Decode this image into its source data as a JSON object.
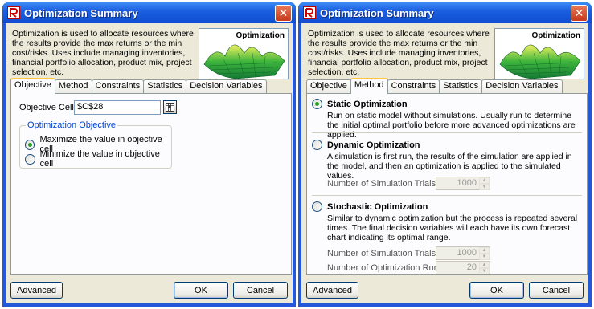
{
  "dialogs": [
    {
      "title": "Optimization Summary",
      "intro": "Optimization is used to allocate resources where the results provide the max returns or the min cost/risks. Uses include managing inventories, financial portfolio allocation, product mix, project selection, etc.",
      "logo_label": "Optimization",
      "tabs": [
        "Objective",
        "Method",
        "Constraints",
        "Statistics",
        "Decision Variables"
      ],
      "active_tab": "Objective",
      "objective": {
        "cell_label": "Objective Cell",
        "cell_value": "$C$28",
        "group_caption": "Optimization Objective",
        "options": [
          {
            "label": "Maximize the value in objective cell",
            "selected": true
          },
          {
            "label": "Minimize the value in objective cell",
            "selected": false
          }
        ]
      },
      "buttons": {
        "advanced": "Advanced",
        "ok": "OK",
        "cancel": "Cancel"
      }
    },
    {
      "title": "Optimization Summary",
      "intro": "Optimization is used to allocate resources where the results provide the max returns or the min cost/risks. Uses include managing inventories, financial portfolio allocation, product mix, project selection, etc.",
      "logo_label": "Optimization",
      "tabs": [
        "Objective",
        "Method",
        "Constraints",
        "Statistics",
        "Decision Variables"
      ],
      "active_tab": "Method",
      "method": {
        "static": {
          "label": "Static Optimization",
          "selected": true,
          "description": "Run on static model without simulations. Usually run to determine the initial optimal portfolio before more advanced optimizations are applied."
        },
        "dynamic": {
          "label": "Dynamic Optimization",
          "selected": false,
          "description": "A simulation is first run, the results of the simulation are applied in the model, and then an optimization is applied to the simulated values.",
          "trials_label": "Number of Simulation Trials",
          "trials_value": "1000"
        },
        "stochastic": {
          "label": "Stochastic Optimization",
          "selected": false,
          "description": "Similar to dynamic optimization but the process is repeated several times. The final decision variables will each have its own forecast chart indicating its optimal range.",
          "trials_label": "Number of Simulation Trials",
          "trials_value": "1000",
          "runs_label": "Number of Optimization Runs",
          "runs_value": "20"
        }
      },
      "buttons": {
        "advanced": "Advanced",
        "ok": "OK",
        "cancel": "Cancel"
      }
    }
  ],
  "colors": {
    "title_bar": "#0f4ed0",
    "close_button": "#c7391c",
    "dialog_face": "#ece9d8",
    "active_tab_accent": "#ffc83c",
    "group_caption": "#0046d5",
    "radio_selected": "#21a121"
  }
}
